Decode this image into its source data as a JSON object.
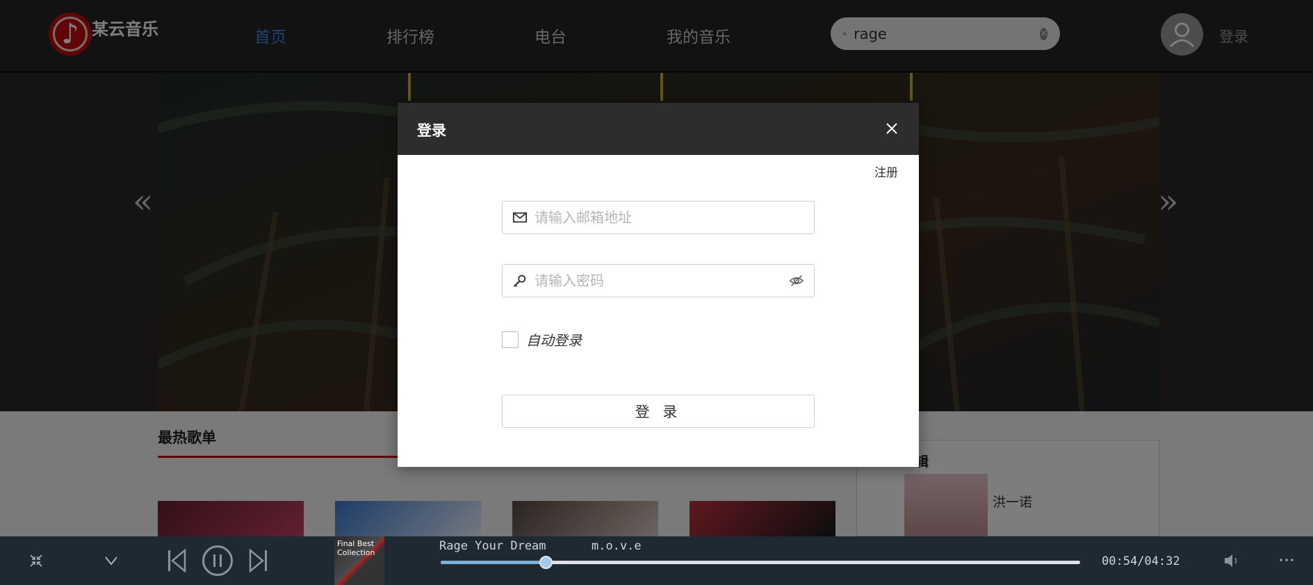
{
  "header": {
    "logo_text": "某云音乐",
    "nav": [
      {
        "label": "首页",
        "active": true
      },
      {
        "label": "排行榜",
        "active": false
      },
      {
        "label": "电台",
        "active": false
      },
      {
        "label": "我的音乐",
        "active": false
      }
    ],
    "search": {
      "value": "rage"
    },
    "login_label": "登录"
  },
  "banner": {
    "prev_arrow": "«",
    "next_arrow": "»"
  },
  "content": {
    "section_title": "最热歌单",
    "side_title": "辑",
    "side_artist": "洪一诺"
  },
  "dialog": {
    "title": "登录",
    "register_label": "注册",
    "email_placeholder": "请输入邮箱地址",
    "password_placeholder": "请输入密码",
    "auto_login_label": "自动登录",
    "submit_label": "登 录"
  },
  "player": {
    "cover_text": "Final Best\nCollection",
    "song_title": "Rage Your Dream",
    "artist": "m.o.v.e",
    "current_time": "00:54",
    "total_time": "04:32",
    "time_display": "00:54/04:32",
    "progress_fraction": 0.164
  },
  "colors": {
    "accent_blue": "#3d89e0",
    "brand_red": "#c20c0c",
    "player_bg": "#1f2934"
  }
}
